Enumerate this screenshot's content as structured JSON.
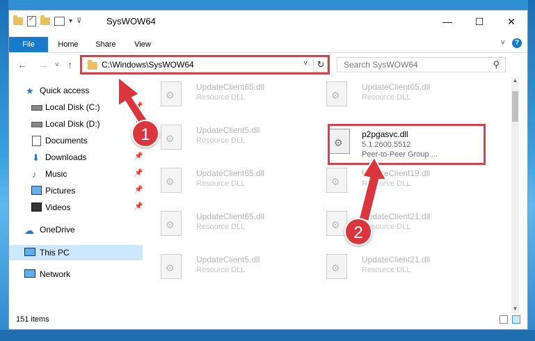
{
  "window": {
    "title": "SysWOW64",
    "controls": {
      "minimize": "—",
      "maximize": "☐",
      "close": "✕"
    }
  },
  "qat": {
    "dropdown": "▾",
    "customize": "⊽"
  },
  "ribbon": {
    "tabs": [
      {
        "label": "File"
      },
      {
        "label": "Home"
      },
      {
        "label": "Share"
      },
      {
        "label": "View"
      }
    ],
    "expand": "˅",
    "help": "?"
  },
  "nav": {
    "back": "←",
    "forward": "→",
    "recent": "˅",
    "up": "↑",
    "address": "C:\\Windows\\SysWOW64",
    "address_dropdown": "˅",
    "refresh": "↻",
    "search_placeholder": "Search SysWOW64",
    "search_icon": "⚲"
  },
  "sidebar": {
    "pin": "📌",
    "items": [
      {
        "label": "Quick access",
        "icon": "star-icon"
      },
      {
        "label": "Local Disk (C:)",
        "icon": "drive-icon",
        "pinned": true
      },
      {
        "label": "Local Disk (D:)",
        "icon": "drive-icon",
        "pinned": true
      },
      {
        "label": "Documents",
        "icon": "document-icon",
        "pinned": true
      },
      {
        "label": "Downloads",
        "icon": "download-icon",
        "pinned": true
      },
      {
        "label": "Music",
        "icon": "music-icon",
        "pinned": true
      },
      {
        "label": "Pictures",
        "icon": "pictures-icon",
        "pinned": true
      },
      {
        "label": "Videos",
        "icon": "video-icon",
        "pinned": true
      },
      {
        "label": "OneDrive",
        "icon": "cloud-icon"
      },
      {
        "label": "This PC",
        "icon": "computer-icon",
        "selected": true
      },
      {
        "label": "Network",
        "icon": "network-icon"
      }
    ]
  },
  "files": {
    "left": [
      {
        "name": "UpdateClient65.dll",
        "type": "Resource DLL"
      },
      {
        "name": "UpdateClient5.dll",
        "type": "Resource DLL"
      },
      {
        "name": "UpdateClient65.dll",
        "type": "Resource DLL"
      },
      {
        "name": "UpdateClient65.dll",
        "type": "Resource DLL"
      },
      {
        "name": "UpdateClient5.dll",
        "type": "Resource DLL"
      }
    ],
    "right": [
      {
        "name": "UpdateClient65.dll",
        "type": "Resource DLL"
      },
      {
        "name": "p2pgasvc.dll",
        "type": "5.1.2600.5512",
        "description": "Peer-to-Peer Group ...",
        "main": true
      },
      {
        "name": "UpdateClient19.dll",
        "type": "Resource DLL"
      },
      {
        "name": "UpdateClient21.dll",
        "type": "Resource DLL"
      },
      {
        "name": "UpdateClient21.dll",
        "type": "Resource DLL"
      }
    ]
  },
  "annotations": {
    "step1": "1",
    "step2": "2",
    "highlight_color": "#d2444d",
    "badge_color": "#d9363e"
  },
  "status": {
    "count": "151 items"
  },
  "colors": {
    "accent": "#1979ca",
    "selected": "#cce8ff"
  }
}
